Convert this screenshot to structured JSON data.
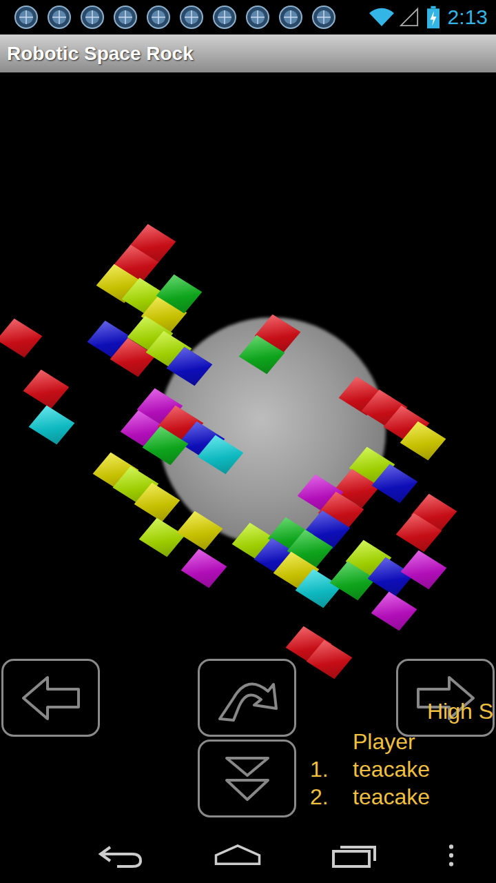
{
  "status_bar": {
    "time": "2:13",
    "notification_count": 10,
    "battery_charging": true
  },
  "window": {
    "title": "Robotic Space Rock"
  },
  "blocks": [
    {
      "color": "#e8101a"
    },
    {
      "color": "#e8101a"
    },
    {
      "color": "#e8e000"
    },
    {
      "color": "#b8f000"
    },
    {
      "color": "#e8e000"
    },
    {
      "color": "#10c020"
    },
    {
      "color": "#e8101a"
    },
    {
      "color": "#1010d8"
    },
    {
      "color": "#e8101a"
    },
    {
      "color": "#b8f000"
    },
    {
      "color": "#b8f000"
    },
    {
      "color": "#1010d8"
    },
    {
      "color": "#e8101a"
    },
    {
      "color": "#10d8e0"
    },
    {
      "color": "#e8101a"
    },
    {
      "color": "#10c020"
    },
    {
      "color": "#d010d8"
    },
    {
      "color": "#d010d8"
    },
    {
      "color": "#e8101a"
    },
    {
      "color": "#1010d8"
    },
    {
      "color": "#10d8e0"
    },
    {
      "color": "#10c020"
    },
    {
      "color": "#e8101a"
    },
    {
      "color": "#e8101a"
    },
    {
      "color": "#e8101a"
    },
    {
      "color": "#e8e000"
    },
    {
      "color": "#e8e000"
    },
    {
      "color": "#b8f000"
    },
    {
      "color": "#e8e000"
    },
    {
      "color": "#b8f000"
    },
    {
      "color": "#e8e000"
    },
    {
      "color": "#d010d8"
    },
    {
      "color": "#b8f000"
    },
    {
      "color": "#e8101a"
    },
    {
      "color": "#1010d8"
    },
    {
      "color": "#d010d8"
    },
    {
      "color": "#e8101a"
    },
    {
      "color": "#1010d8"
    },
    {
      "color": "#e8101a"
    },
    {
      "color": "#e8101a"
    },
    {
      "color": "#b8f000"
    },
    {
      "color": "#10c020"
    },
    {
      "color": "#1010d8"
    },
    {
      "color": "#10c020"
    },
    {
      "color": "#e8e000"
    },
    {
      "color": "#10d8e0"
    },
    {
      "color": "#b8f000"
    },
    {
      "color": "#10c020"
    },
    {
      "color": "#1010d8"
    },
    {
      "color": "#d010d8"
    },
    {
      "color": "#d010d8"
    },
    {
      "color": "#e8101a"
    },
    {
      "color": "#e8101a"
    }
  ],
  "high_scores": {
    "title": "High S",
    "column": "Player",
    "entries": [
      {
        "rank": "1.",
        "name": "teacake"
      },
      {
        "rank": "2.",
        "name": "teacake"
      }
    ]
  }
}
